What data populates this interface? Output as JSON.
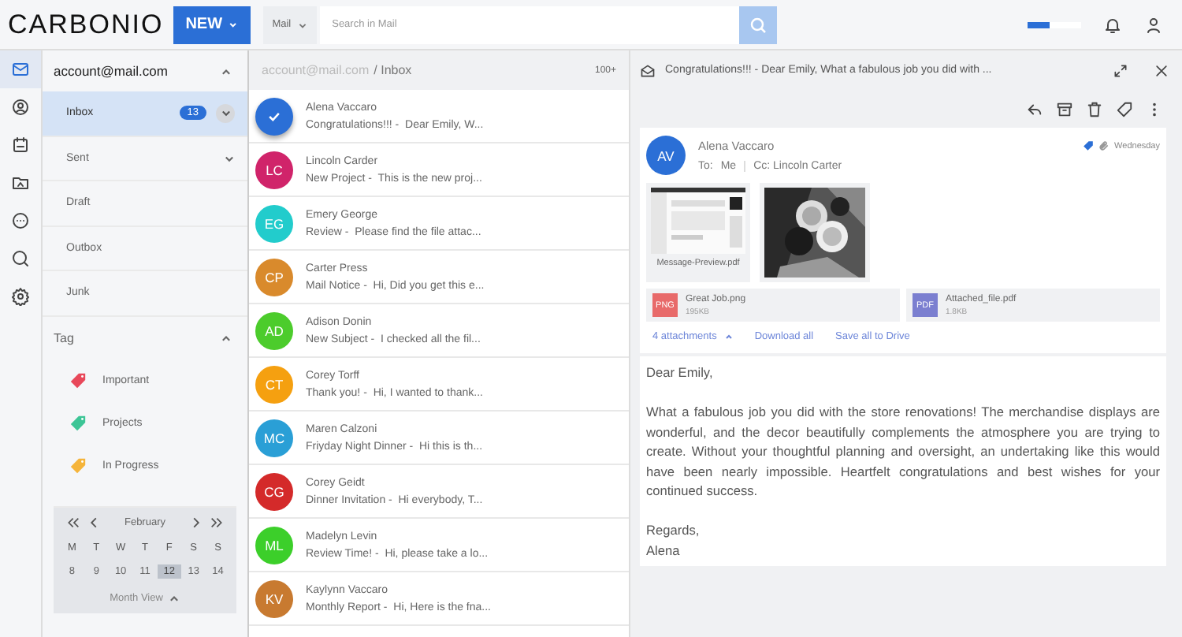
{
  "topbar": {
    "logo": "CARBONIO",
    "new_button": "NEW",
    "module": "Mail",
    "search": {
      "placeholder": "Search in Mail"
    },
    "quota": {
      "level": 0.4
    }
  },
  "rail": [
    {
      "selected": true
    },
    {
      "selected": false
    },
    {
      "selected": false
    },
    {
      "selected": false
    },
    {
      "selected": false
    },
    {
      "selected": false
    },
    {
      "selected": false
    }
  ],
  "folders": {
    "account": "account@mail.com",
    "items": [
      {
        "label": "Inbox",
        "selected": true,
        "badge": "13",
        "expandable": true
      },
      {
        "label": "Sent",
        "selected": false,
        "expandable": true
      },
      {
        "label": "Draft",
        "selected": false,
        "expandable": false
      },
      {
        "label": "Outbox",
        "selected": false,
        "expandable": false
      },
      {
        "label": "Junk",
        "selected": false,
        "expandable": false
      }
    ],
    "tag_header": "Tag",
    "tags": [
      {
        "label": "Important",
        "color": "#e8485a"
      },
      {
        "label": "Projects",
        "color": "#3cc596"
      },
      {
        "label": "In Progress",
        "color": "#f5b43a"
      }
    ]
  },
  "calendar": {
    "month": "February",
    "weekdays": [
      "M",
      "T",
      "W",
      "T",
      "F",
      "S",
      "S"
    ],
    "days": [
      {
        "day": "8",
        "selected": false
      },
      {
        "day": "9",
        "selected": false
      },
      {
        "day": "10",
        "selected": false
      },
      {
        "day": "11",
        "selected": false
      },
      {
        "day": "12",
        "selected": true
      },
      {
        "day": "13",
        "selected": false
      },
      {
        "day": "14",
        "selected": false
      }
    ],
    "view_button": "Month View"
  },
  "list": {
    "breadcrumb_account": "account@mail.com",
    "breadcrumb_folder": "/ Inbox",
    "count": "100+",
    "rows": [
      {
        "color": "#2b6fd6",
        "selected": true,
        "sender": "Alena Vaccaro",
        "subject": "Congratulations!!! -",
        "preview": "Dear Emily, W..."
      },
      {
        "initials": "LC",
        "color": "#d0246a",
        "selected": false,
        "sender": "Lincoln Carder",
        "subject": "New Project -",
        "preview": "This is the new proj..."
      },
      {
        "initials": "EG",
        "color": "#22cccc",
        "selected": false,
        "sender": "Emery George",
        "subject": "Review -",
        "preview": "Please find the file attac..."
      },
      {
        "initials": "CP",
        "color": "#d98a2c",
        "selected": false,
        "sender": "Carter Press",
        "subject": "Mail Notice -",
        "preview": "Hi, Did you get this e..."
      },
      {
        "initials": "AD",
        "color": "#4ccc2c",
        "selected": false,
        "sender": "Adison Donin",
        "subject": "New Subject -",
        "preview": "I checked all the fil..."
      },
      {
        "initials": "CT",
        "color": "#f5a010",
        "selected": false,
        "sender": "Corey Torff",
        "subject": "Thank you! -",
        "preview": "Hi, I wanted to thank..."
      },
      {
        "initials": "MC",
        "color": "#2a9fd6",
        "selected": false,
        "sender": "Maren Calzoni",
        "subject": "Friyday Night Dinner -",
        "preview": "Hi this is th..."
      },
      {
        "initials": "CG",
        "color": "#d42a2a",
        "selected": false,
        "sender": "Corey Geidt",
        "subject": "Dinner Invitation -",
        "preview": "Hi everybody, T..."
      },
      {
        "initials": "ML",
        "color": "#3ccf2a",
        "selected": false,
        "sender": "Madelyn Levin",
        "subject": "Review Time! -",
        "preview": "Hi, please take a lo..."
      },
      {
        "initials": "KV",
        "color": "#c87a30",
        "selected": false,
        "sender": "Kaylynn Vaccaro",
        "subject": "Monthly Report -",
        "preview": "Hi, Here is the fna..."
      }
    ]
  },
  "reader": {
    "title": "Congratulations!!! - Dear Emily, What a fabulous job you did with ...",
    "sender": {
      "initials": "AV",
      "name": "Alena Vaccaro",
      "to_label": "To:",
      "to": "Me",
      "cc": "Cc: Lincoln Carter",
      "date": "Wednesday"
    },
    "previews": [
      {
        "kind": "document",
        "name": "Message-Preview.pdf"
      },
      {
        "kind": "picture"
      }
    ],
    "files": [
      {
        "type": "PNG",
        "color": "#e86a6a",
        "name": "Great Job.png",
        "size": "195KB"
      },
      {
        "type": "PDF",
        "color": "#7b7fd0",
        "name": "Attached_file.pdf",
        "size": "1.8KB"
      }
    ],
    "attachment_links": [
      "4 attachments",
      "Download all",
      "Save all to Drive"
    ],
    "body": [
      "Dear Emily,",
      "What a fabulous job you did with the store renovations! The merchandise displays are wonderful, and the decor beautifully complements the atmosphere you are trying to create. Without your thoughtful planning and oversight, an undertaking like this would have been nearly impossible. Heartfelt congratulations and best wishes for your continued success.",
      "Regards,",
      "Alena"
    ]
  }
}
